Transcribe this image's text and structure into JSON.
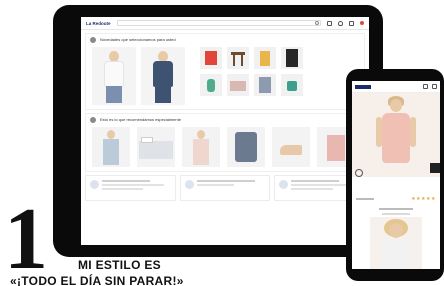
{
  "tablet": {
    "header": {
      "logo_text": "La Redoute"
    },
    "section_1": {
      "title": "Novedades que seleccionamos para usted"
    },
    "section_2": {
      "title": "Esto es lo que recomendamos especialmente"
    },
    "cards": [
      {
        "title": "Más que grande"
      },
      {
        "title": "La colecciones para el fin de semana"
      },
      {
        "title": "Más que grande"
      }
    ]
  },
  "phone": {
    "rating": "★★★★★",
    "link_text": "Descripción detallada"
  },
  "article": {
    "number": "1",
    "title_line1": "MI ESTILO ES",
    "title_line2": "«¡TODO EL DÍA SIN PARAR!»"
  },
  "colors": {
    "brand": "#1a2c6b",
    "device": "#0a0a0a",
    "star": "#e3a83c"
  }
}
